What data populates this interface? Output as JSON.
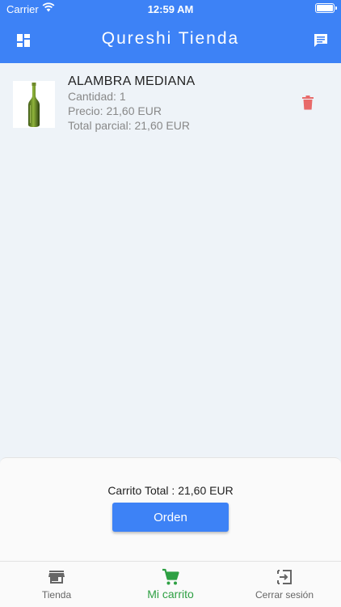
{
  "status_bar": {
    "carrier": "Carrier",
    "time": "12:59 AM"
  },
  "app_bar": {
    "title": "Qureshi Tienda",
    "left_icon": "dashboard-icon",
    "right_icon": "message-icon"
  },
  "cart": {
    "items": [
      {
        "name": "ALAMBRA MEDIANA",
        "quantity": "Cantidad: 1",
        "price": "Precio: 21,60 EUR",
        "subtotal": "Total parcial: 21,60 EUR",
        "image_icon": "green-bottle-image"
      }
    ],
    "total": "Carrito Total : 21,60 EUR",
    "order_button": "Orden"
  },
  "tab_bar": {
    "tabs": [
      {
        "label": "Tienda",
        "icon": "store-icon"
      },
      {
        "label": "Mi carrito",
        "icon": "cart-icon",
        "active": true
      },
      {
        "label": "Cerrar sesión",
        "icon": "logout-icon"
      }
    ]
  },
  "colors": {
    "primary": "#3d82f6",
    "active_tab": "#2ea043",
    "delete": "#e86a6a"
  }
}
